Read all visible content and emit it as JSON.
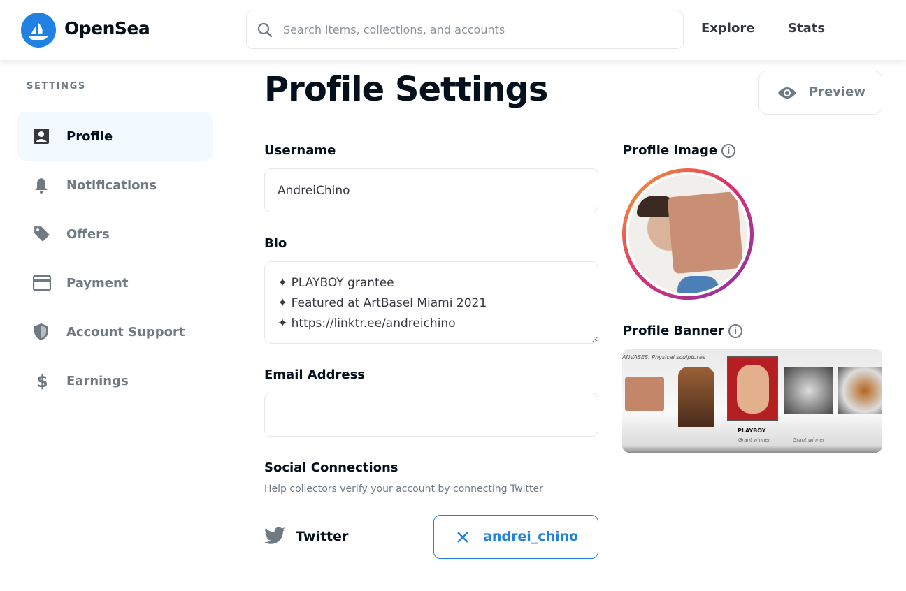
{
  "header": {
    "brand": "OpenSea",
    "search_placeholder": "Search items, collections, and accounts",
    "search_value": "",
    "nav": [
      {
        "label": "Explore"
      },
      {
        "label": "Stats"
      }
    ]
  },
  "sidebar": {
    "caption": "SETTINGS",
    "items": [
      {
        "label": "Profile",
        "icon": "profile-icon",
        "active": true
      },
      {
        "label": "Notifications",
        "icon": "bell-icon"
      },
      {
        "label": "Offers",
        "icon": "tag-icon"
      },
      {
        "label": "Payment",
        "icon": "credit-card-icon"
      },
      {
        "label": "Account Support",
        "icon": "shield-icon"
      },
      {
        "label": "Earnings",
        "icon": "dollar-icon"
      }
    ]
  },
  "main": {
    "title": "Profile Settings",
    "preview_label": "Preview",
    "username": {
      "label": "Username",
      "value": "AndreiChino"
    },
    "bio": {
      "label": "Bio",
      "value": "✦ PLAYBOY grantee\n✦ Featured at ArtBasel Miami 2021\n✦ https://linktr.ee/andreichino"
    },
    "email": {
      "label": "Email Address",
      "value": ""
    },
    "social": {
      "title": "Social Connections",
      "subtitle": "Help collectors verify your account by connecting Twitter",
      "twitter_label": "Twitter",
      "connected_account": "andrei_chino"
    },
    "profile_image": {
      "label": "Profile Image",
      "info": "i"
    },
    "profile_banner": {
      "label": "Profile Banner",
      "info": "i",
      "caption": "ANVASES: Physical sculptures",
      "badge_1": "PLAYBOY",
      "grant_1": "Grant winner",
      "grant_2": "Grant winner"
    }
  },
  "colors": {
    "accent": "#2081e2",
    "text": "#04111d",
    "muted": "#707a83",
    "active_bg": "#f3faff"
  }
}
